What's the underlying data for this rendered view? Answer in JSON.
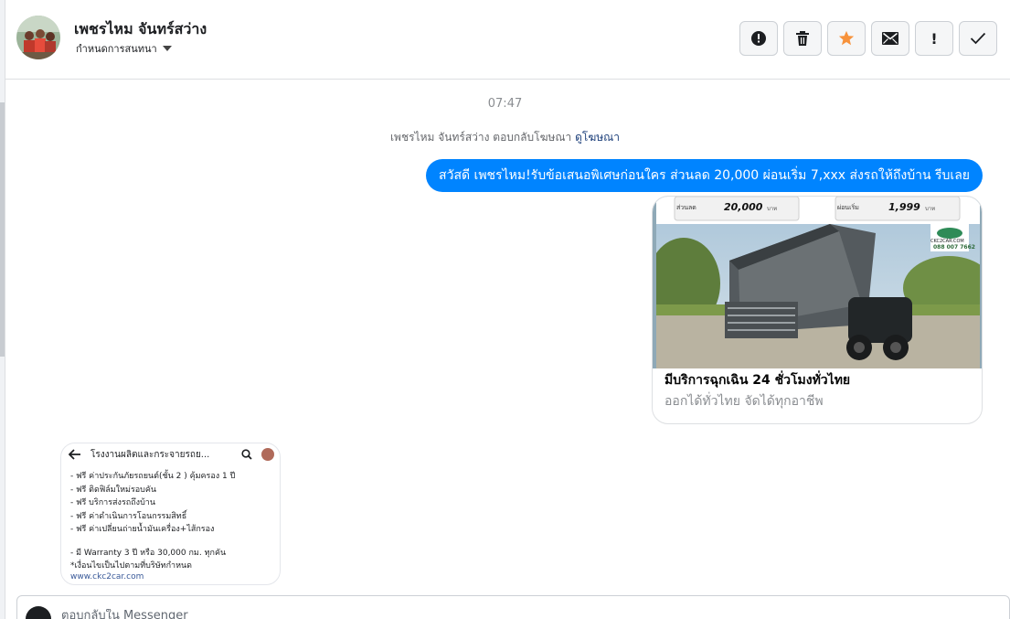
{
  "contact": {
    "name": "เพชรไหม จันทร์สว่าง",
    "label_dropdown": "กำหนดการสนทนา"
  },
  "toolbar": {
    "icons": [
      "alert-icon",
      "trash-icon",
      "star-icon",
      "envelope-icon",
      "exclamation-icon",
      "check-icon"
    ],
    "exclamation_glyph": "!"
  },
  "conversation": {
    "timestamp": "07:47",
    "reply_note": "เพชรไหม จันทร์สว่าง ตอบกลับโฆษณา",
    "reply_note_link": "ดูโฆษณา",
    "outgoing_message": "สวัสดี เพชรไหม!รับข้อเสนอพิเศษก่อนใคร ส่วนลด 20,000 ผ่อนเริ่ม 7,xxx ส่งรถให้ถึงบ้าน รีบเลย"
  },
  "ad_card": {
    "price_left_label": "ส่วนลด",
    "price_left_value": "20,000",
    "price_left_unit": "บาท",
    "price_right_label": "ผ่อนเริ่ม",
    "price_right_value": "1,999",
    "price_right_unit": "บาท",
    "brand_text": "CKC2CAR.COM",
    "brand_phone": "088 007 7662",
    "headline": "มีบริการฉุกเฉิน 24 ชั่วโมงทั่วไทย",
    "description": "ออกได้ทั่วไทย จัดได้ทุกอาชีพ"
  },
  "screenshot_card": {
    "title": "โรงงานผลิตและกระจายรถย...",
    "lines": [
      "- ฟรี ค่าประกันภัยรถยนต์(ชั้น 2 ) คุ้มครอง 1 ปี",
      "- ฟรี ติดฟิล์มใหม่รอบคัน",
      "- ฟรี บริการส่งรถถึงบ้าน",
      "- ฟรี ค่าดำเนินการโอนกรรมสิทธิ์",
      "- ฟรี ค่าเปลี่ยนถ่ายน้ำมันเครื่อง+ไส้กรอง",
      "",
      "- มี Warranty 3 ปี หรือ 30,000 กม. ทุกคัน",
      "*เงื่อนไขเป็นไปตามที่บริษัทกำหนด"
    ],
    "link": "www.ckc2car.com"
  },
  "composer": {
    "placeholder": "ตอบกลับใน Messenger"
  },
  "colors": {
    "accent": "#0084ff",
    "star": "#f7923b",
    "link": "#1c3f7a"
  }
}
